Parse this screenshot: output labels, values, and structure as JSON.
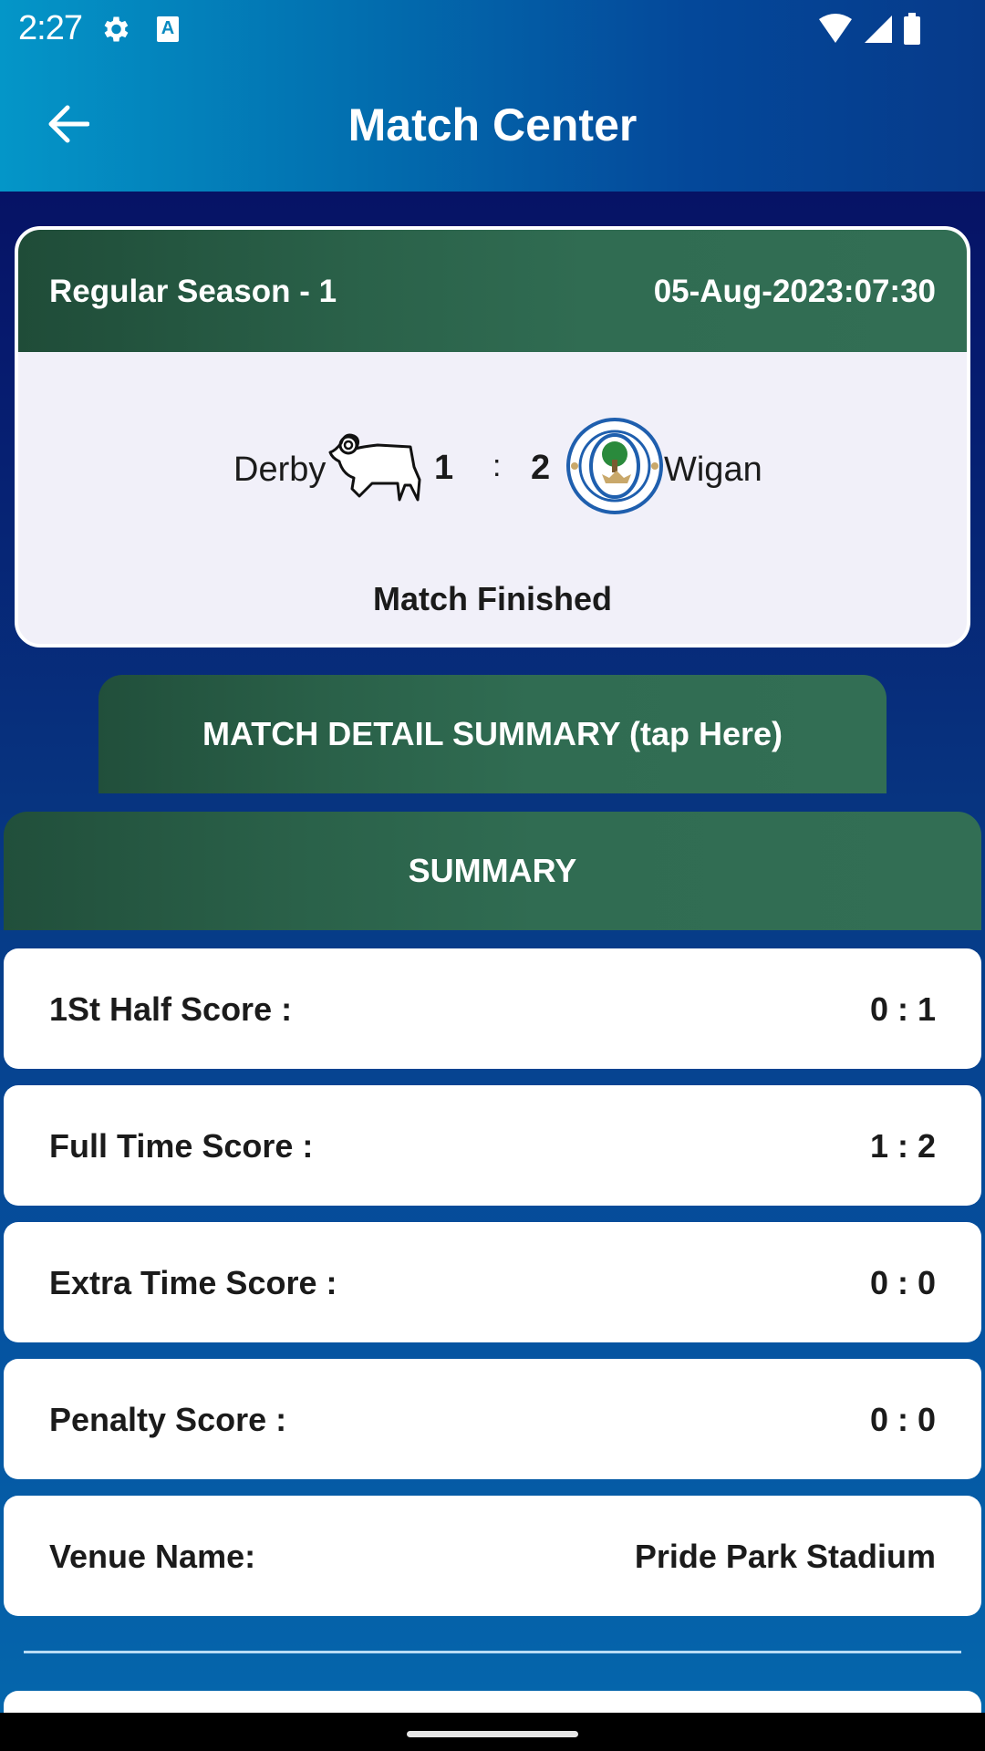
{
  "status_bar": {
    "time": "2:27",
    "icons": [
      "gear-icon",
      "keyboard-a-icon",
      "wifi-icon",
      "signal-icon",
      "battery-icon"
    ]
  },
  "toolbar": {
    "back_icon": "arrow-left-icon",
    "title": "Match Center"
  },
  "match": {
    "round": "Regular Season - 1",
    "datetime": "05-Aug-2023:07:30",
    "home_team": {
      "name": "Derby",
      "logo": "derby-ram-logo",
      "score": "1"
    },
    "separator": ":",
    "away_team": {
      "name": "Wigan",
      "logo": "wigan-athletic-crest",
      "score": "2"
    },
    "status": "Match Finished"
  },
  "detail_button": {
    "label": "MATCH DETAIL SUMMARY (tap Here)"
  },
  "summary": {
    "header": "SUMMARY",
    "rows": [
      {
        "label": "1St Half Score :",
        "value": "0 : 1"
      },
      {
        "label": "Full Time Score :",
        "value": "1 : 2"
      },
      {
        "label": "Extra Time Score :",
        "value": "0 : 0"
      },
      {
        "label": "Penalty Score :",
        "value": "0 : 0"
      },
      {
        "label": "Venue Name:",
        "value": "Pride Park Stadium"
      }
    ]
  },
  "colors": {
    "header_green": "#306c52",
    "appbar_blue": "#0270b0",
    "card_bg": "#f1f0f9"
  }
}
